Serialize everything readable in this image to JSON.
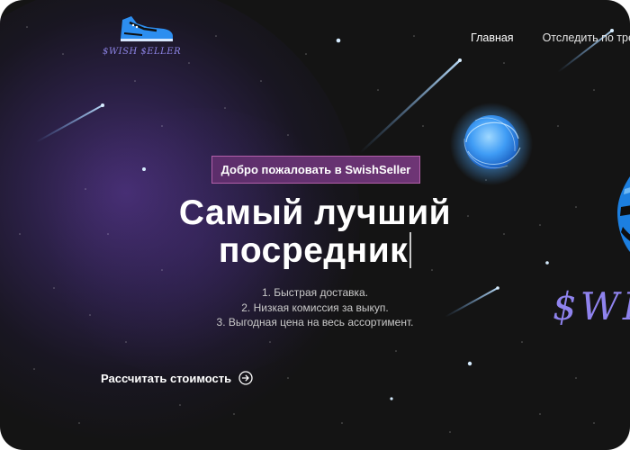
{
  "brand": {
    "logo_text": "$WISH $ELLER",
    "logo_icon": "sneaker-icon",
    "big_logo_text": "$WI"
  },
  "nav": {
    "items": [
      {
        "label": "Главная"
      },
      {
        "label": "Отследить по тре"
      }
    ]
  },
  "hero": {
    "badge": "Добро пожаловать в SwishSeller",
    "title_line1": "Самый лучший",
    "title_line2": "посредник",
    "features": [
      "1. Быстрая доставка.",
      "2. Низкая комиссия за выкуп.",
      "3. Выгодная цена на весь ассортимент."
    ],
    "cta_label": "Рассчитать стоимость",
    "cta_icon": "arrow-right-circle-icon"
  },
  "colors": {
    "background": "#141414",
    "accent_purple": "#8f83ee",
    "badge_bg": "#5c2e6b",
    "badge_border": "#b25fa9",
    "planet_blue": "#4aa8ff"
  }
}
